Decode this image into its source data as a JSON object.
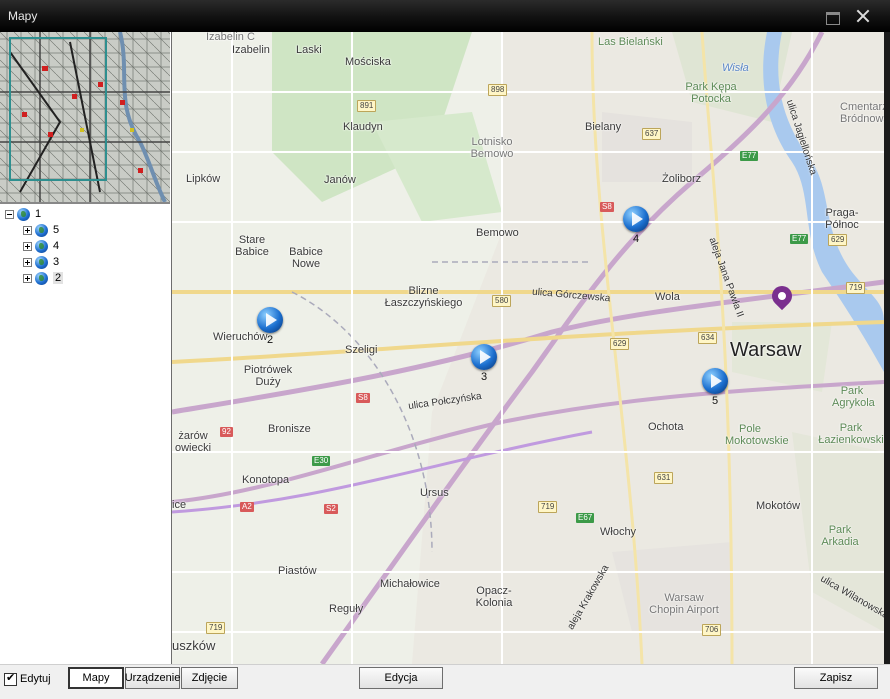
{
  "window": {
    "title": "Mapy"
  },
  "tree": {
    "root": {
      "label": "1"
    },
    "children": [
      {
        "label": "5"
      },
      {
        "label": "4"
      },
      {
        "label": "3"
      },
      {
        "label": "2"
      }
    ]
  },
  "map": {
    "places": [
      {
        "text": "Izabelin C"
      },
      {
        "text": "Izabelin"
      },
      {
        "text": "Laski"
      },
      {
        "text": "Mościska"
      },
      {
        "text": "Klaudyn"
      },
      {
        "text": "Janów"
      },
      {
        "text": "Lipków"
      },
      {
        "text": "Stare Babice"
      },
      {
        "text": "Babice Nowe"
      },
      {
        "text": "Bemowo"
      },
      {
        "text": "Blizne Łaszczyńskiego"
      },
      {
        "text": "Wieruchów"
      },
      {
        "text": "Szeligi"
      },
      {
        "text": "Piotrówek Duży"
      },
      {
        "text": "Bronisze"
      },
      {
        "text": "Konotopa"
      },
      {
        "text": "Ursus"
      },
      {
        "text": "Piastów"
      },
      {
        "text": "Michałowice"
      },
      {
        "text": "Reguły"
      },
      {
        "text": "Opacz-Kolonia"
      },
      {
        "text": "Włochy"
      },
      {
        "text": "Ochota"
      },
      {
        "text": "Bielany"
      },
      {
        "text": "Żoliborz"
      },
      {
        "text": "Wola"
      },
      {
        "text": "Praga-Północ"
      },
      {
        "text": "Park Agrykola"
      },
      {
        "text": "Pole Mokotowskie"
      },
      {
        "text": "Park Łazienkowski"
      },
      {
        "text": "Mokotów"
      },
      {
        "text": "Park Arkadia"
      },
      {
        "text": "Warsaw Chopin Airport"
      },
      {
        "text": "Cmentarz Bródnowski"
      },
      {
        "text": "Park Kępa Potocka"
      },
      {
        "text": "Lotnisko Bemowo"
      },
      {
        "text": "Las Bielański"
      },
      {
        "text": "uszków"
      },
      {
        "text": "ice"
      },
      {
        "text": "żarów owiecki"
      }
    ],
    "city": "Warsaw",
    "river": "Wisła",
    "roads": [
      {
        "text": "ulica Górczewska"
      },
      {
        "text": "ulica Połczyńska"
      },
      {
        "text": "aleja Jana Pawła II"
      },
      {
        "text": "aleja Krakowska"
      },
      {
        "text": "ulica Jagiellońska"
      },
      {
        "text": "ulica Wilanowska"
      }
    ],
    "shields": [
      {
        "text": "891"
      },
      {
        "text": "898"
      },
      {
        "text": "637"
      },
      {
        "text": "580"
      },
      {
        "text": "S8"
      },
      {
        "text": "E77"
      },
      {
        "text": "629"
      },
      {
        "text": "634"
      },
      {
        "text": "E30"
      },
      {
        "text": "92"
      },
      {
        "text": "631"
      },
      {
        "text": "719"
      },
      {
        "text": "E67"
      },
      {
        "text": "A2"
      },
      {
        "text": "S2"
      },
      {
        "text": "706"
      },
      {
        "text": "E77"
      },
      {
        "text": "629"
      },
      {
        "text": "719"
      },
      {
        "text": "719"
      },
      {
        "text": "S8"
      }
    ],
    "devices": [
      {
        "label": "2"
      },
      {
        "label": "3"
      },
      {
        "label": "4"
      },
      {
        "label": "5"
      }
    ]
  },
  "bottom": {
    "edit_label": "Edytuj",
    "tab_maps": "Mapy",
    "tab_devices": "Urządzenie",
    "tab_photos": "Zdjęcie",
    "edit_button": "Edycja",
    "save_button": "Zapisz"
  }
}
